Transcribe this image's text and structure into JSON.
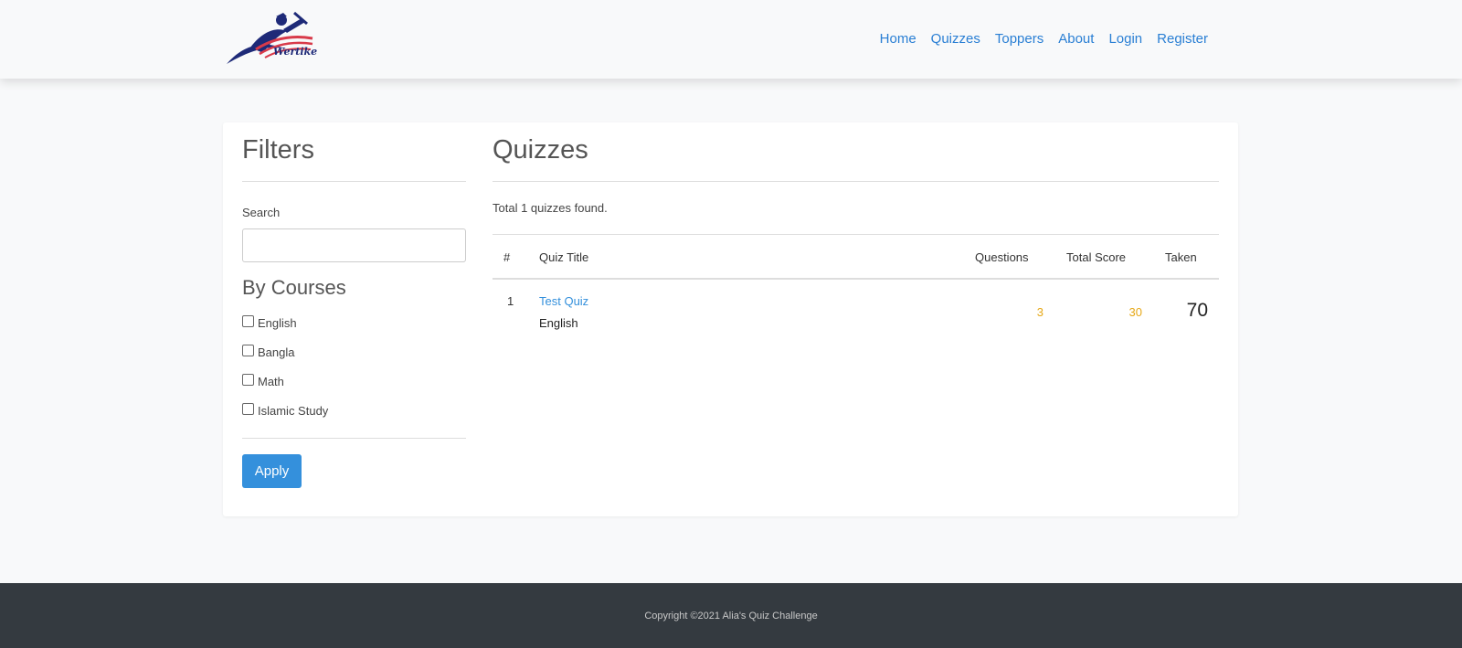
{
  "header": {
    "logo_text": "Wertike",
    "nav": [
      {
        "label": "Home"
      },
      {
        "label": "Quizzes"
      },
      {
        "label": "Toppers"
      },
      {
        "label": "About"
      },
      {
        "label": "Login"
      },
      {
        "label": "Register"
      }
    ]
  },
  "filters": {
    "title": "Filters",
    "search_label": "Search",
    "search_value": "",
    "courses_title": "By Courses",
    "courses": [
      {
        "label": "English",
        "checked": false
      },
      {
        "label": "Bangla",
        "checked": false
      },
      {
        "label": "Math",
        "checked": false
      },
      {
        "label": "Islamic Study",
        "checked": false
      }
    ],
    "apply_label": "Apply"
  },
  "quizzes": {
    "title": "Quizzes",
    "total_text": "Total 1 quizzes found.",
    "columns": {
      "num": "#",
      "title": "Quiz Title",
      "questions": "Questions",
      "total_score": "Total Score",
      "taken": "Taken"
    },
    "rows": [
      {
        "num": "1",
        "title": "Test Quiz",
        "course": "English",
        "questions": "3",
        "total_score": "30",
        "taken": "70"
      }
    ]
  },
  "footer": {
    "copyright": "Copyright ©2021 Alia's Quiz Challenge"
  },
  "colors": {
    "link": "#3490dc",
    "accent_orange": "#e6a817",
    "footer_bg": "#343a40",
    "button_bg": "#3490dc"
  }
}
